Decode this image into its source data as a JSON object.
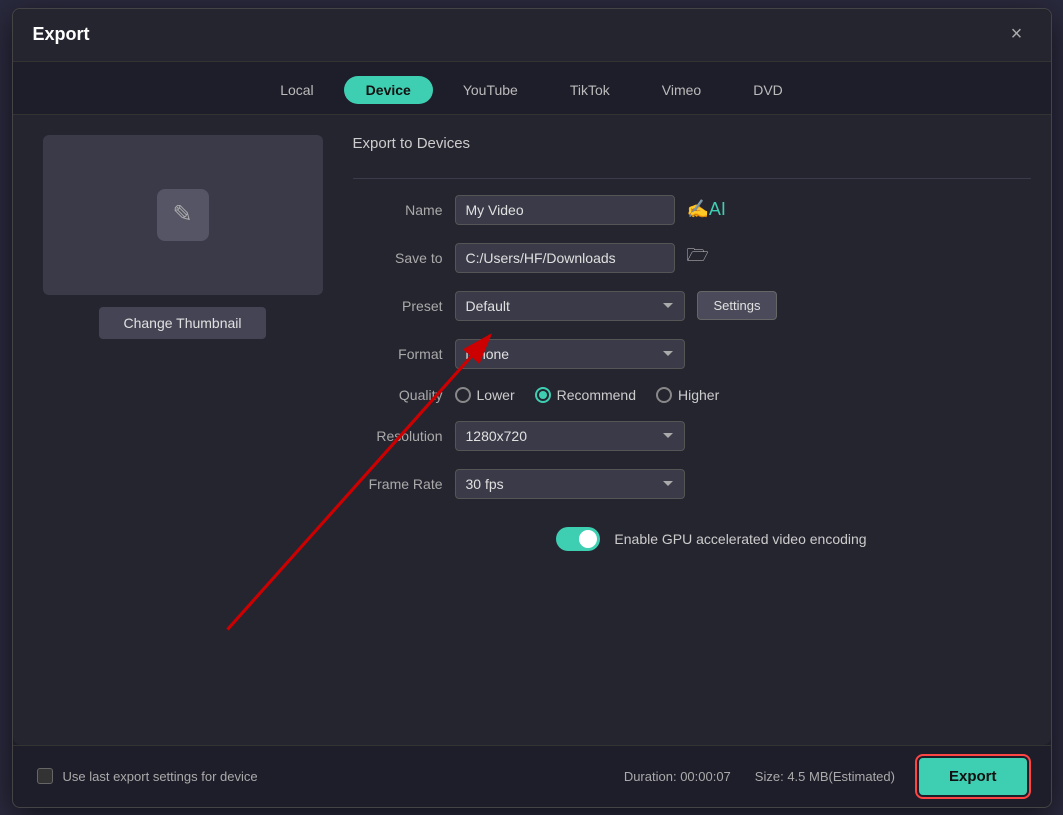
{
  "dialog": {
    "title": "Export",
    "close_label": "×"
  },
  "tabs": [
    {
      "id": "local",
      "label": "Local",
      "active": false
    },
    {
      "id": "device",
      "label": "Device",
      "active": true
    },
    {
      "id": "youtube",
      "label": "YouTube",
      "active": false
    },
    {
      "id": "tiktok",
      "label": "TikTok",
      "active": false
    },
    {
      "id": "vimeo",
      "label": "Vimeo",
      "active": false
    },
    {
      "id": "dvd",
      "label": "DVD",
      "active": false
    }
  ],
  "thumbnail": {
    "change_btn_label": "Change Thumbnail"
  },
  "export_form": {
    "section_title": "Export to Devices",
    "name_label": "Name",
    "name_value": "My Video",
    "save_to_label": "Save to",
    "save_to_value": "C:/Users/HF/Downloads",
    "preset_label": "Preset",
    "preset_value": "Default",
    "settings_btn_label": "Settings",
    "format_label": "Format",
    "format_value": "iPhone",
    "quality_label": "Quality",
    "quality_options": [
      {
        "id": "lower",
        "label": "Lower",
        "selected": false
      },
      {
        "id": "recommend",
        "label": "Recommend",
        "selected": true
      },
      {
        "id": "higher",
        "label": "Higher",
        "selected": false
      }
    ],
    "resolution_label": "Resolution",
    "resolution_value": "1280x720",
    "frame_rate_label": "Frame Rate",
    "frame_rate_value": "30 fps",
    "gpu_label": "Enable GPU accelerated video encoding",
    "gpu_enabled": true
  },
  "footer": {
    "checkbox_label": "Use last export settings for device",
    "duration_label": "Duration:",
    "duration_value": "00:00:07",
    "size_label": "Size:",
    "size_value": "4.5 MB(Estimated)",
    "export_btn_label": "Export"
  },
  "icons": {
    "close": "✕",
    "pencil": "✎",
    "ai": "✍",
    "folder": "🗁",
    "arrow_down": "▾"
  }
}
